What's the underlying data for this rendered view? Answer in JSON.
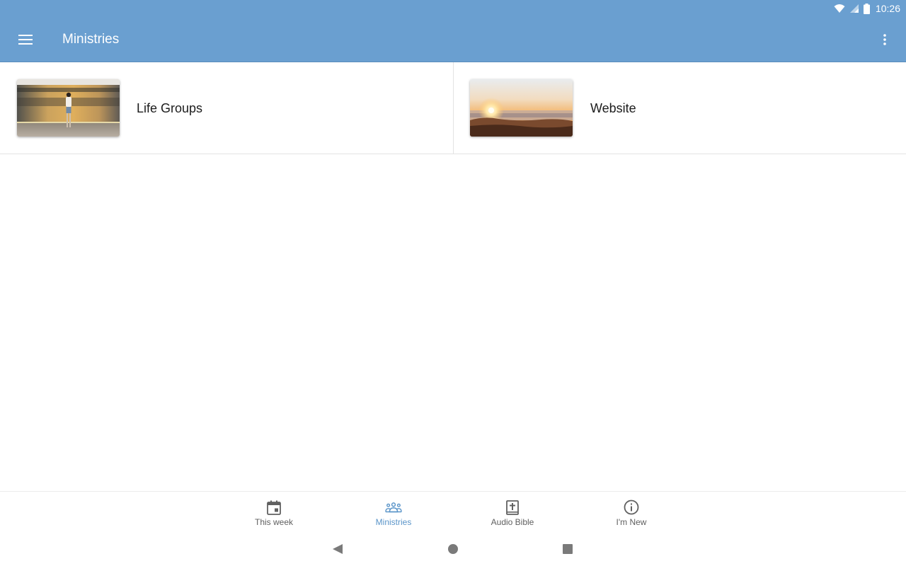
{
  "status_bar": {
    "time": "10:26",
    "icons": [
      "wifi-icon",
      "signal-icon",
      "battery-icon"
    ]
  },
  "app_bar": {
    "title": "Ministries",
    "menu_icon": "hamburger-menu-icon",
    "overflow_icon": "more-vert-icon"
  },
  "ministries": [
    {
      "label": "Life Groups",
      "image": "train-station-photo"
    },
    {
      "label": "Website",
      "image": "sunrise-photo"
    }
  ],
  "bottom_nav": {
    "active": "Ministries",
    "items": [
      {
        "label": "This week",
        "icon": "calendar-icon"
      },
      {
        "label": "Ministries",
        "icon": "people-group-icon"
      },
      {
        "label": "Audio Bible",
        "icon": "bible-icon"
      },
      {
        "label": "I'm New",
        "icon": "info-icon"
      }
    ]
  },
  "colors": {
    "primary": "#6a9fd0",
    "active_nav": "#5b95c9",
    "inactive_nav": "#5f5f5f",
    "divider": "#e3e3e3"
  }
}
